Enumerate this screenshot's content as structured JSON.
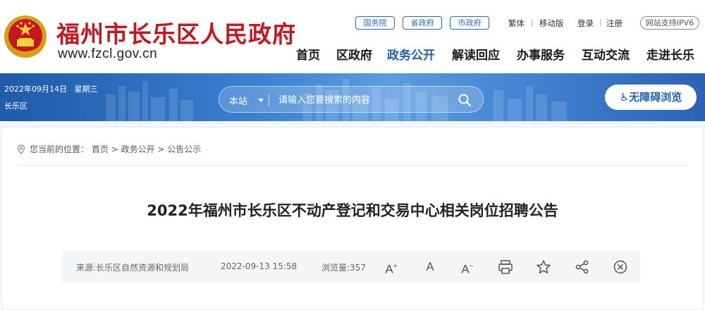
{
  "header": {
    "site_title": "福州市长乐区人民政府",
    "site_url": "www.fzcl.gov.cn",
    "gov_links": [
      "国务院",
      "省政府",
      "市政府"
    ],
    "traditional": "繁体",
    "mobile": "移动版",
    "login": "登录",
    "register": "注册",
    "ipv6": "网站支持IPV6",
    "nav": [
      "首页",
      "区政府",
      "政务公开",
      "解读回应",
      "办事服务",
      "互动交流",
      "走进长乐"
    ],
    "active_nav": "政务公开"
  },
  "banner": {
    "date": "2022年09月14日",
    "weekday": "星期三",
    "district": "长乐区",
    "search_scope": "本站",
    "search_placeholder": "请输入您要搜索的内容",
    "accessibility_label": "无障碍浏览"
  },
  "breadcrumb": {
    "prefix": "您当前的位置：",
    "items": [
      "首页",
      "政务公开",
      "公告公示"
    ]
  },
  "article": {
    "title": "2022年福州市长乐区不动产登记和交易中心相关岗位招聘公告",
    "source": "来源:长乐区自然资源和规划局",
    "datetime": "2022-09-13 15:58",
    "views": "浏览量:357"
  },
  "icons": {
    "font_larger": "font-increase-icon",
    "font_normal": "font-default-icon",
    "font_smaller": "font-decrease-icon",
    "print": "print-icon",
    "favorite": "star-icon",
    "share": "share-icon",
    "close": "close-icon"
  },
  "colors": {
    "brand_red": "#c8161d",
    "brand_blue": "#1f5fb5"
  }
}
